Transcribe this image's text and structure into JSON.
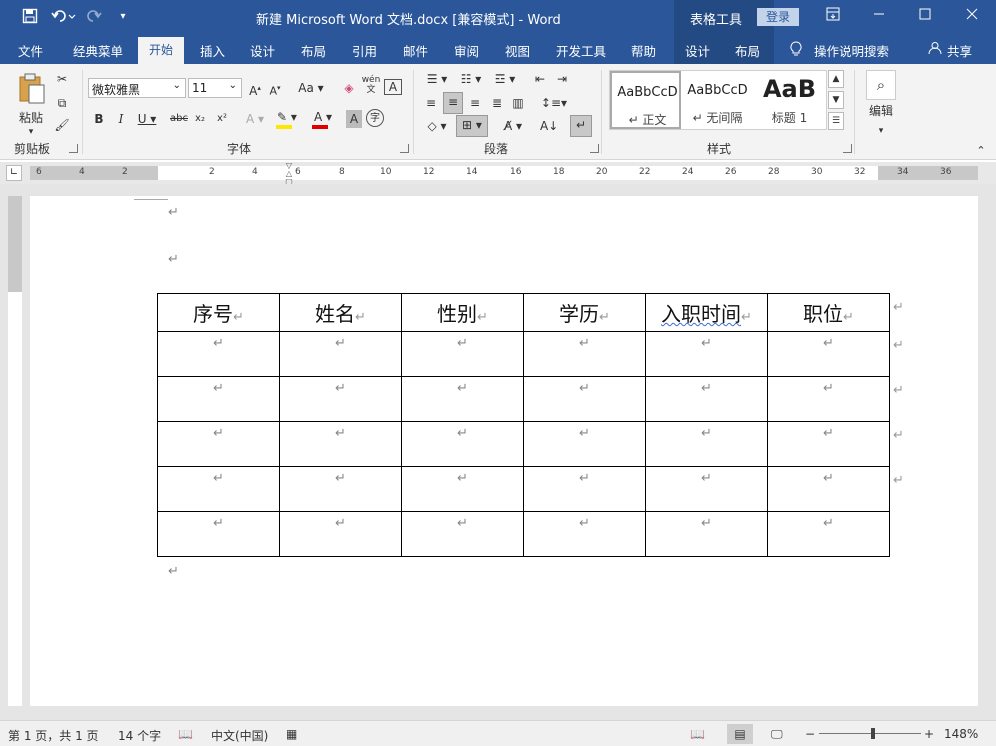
{
  "titlebar": {
    "doc_title": "新建 Microsoft Word 文档.docx [兼容模式]  -  Word",
    "context_tab": "表格工具",
    "login": "登录",
    "undo_icon": "undo-icon",
    "redo_icon": "redo-icon",
    "save_icon": "save-icon"
  },
  "menu": {
    "items": [
      "文件",
      "经典菜单",
      "开始",
      "插入",
      "设计",
      "布局",
      "引用",
      "邮件",
      "审阅",
      "视图",
      "开发工具",
      "帮助"
    ],
    "context_items": [
      "设计",
      "布局"
    ],
    "tell_me": "操作说明搜索",
    "share": "共享"
  },
  "ribbon": {
    "clipboard": {
      "paste": "粘贴",
      "label": "剪贴板"
    },
    "font": {
      "name": "微软雅黑",
      "size": "11",
      "label": "字体",
      "wen": "wén",
      "wen_char": "文"
    },
    "paragraph": {
      "label": "段落"
    },
    "styles": {
      "label": "样式",
      "items": [
        {
          "preview": "AaBbCcD",
          "name": "↵ 正文"
        },
        {
          "preview": "AaBbCcD",
          "name": "↵ 无间隔"
        },
        {
          "preview": "AaB",
          "name": "标题 1"
        }
      ]
    },
    "editing": {
      "label": "编辑"
    }
  },
  "ruler": {
    "numbers": [
      "6",
      "4",
      "2",
      "2",
      "4",
      "6",
      "8",
      "10",
      "12",
      "14",
      "16",
      "18",
      "20",
      "22",
      "24",
      "26",
      "28",
      "30",
      "32",
      "34",
      "36"
    ]
  },
  "document": {
    "return_mark": "↵",
    "table": {
      "headers": [
        "序号",
        "姓名",
        "性别",
        "学历",
        "入职时间",
        "职位"
      ],
      "rows": [
        [
          "↵",
          "↵",
          "↵",
          "↵",
          "↵",
          "↵"
        ],
        [
          "↵",
          "↵",
          "↵",
          "↵",
          "↵",
          "↵"
        ],
        [
          "↵",
          "↵",
          "↵",
          "↵",
          "↵",
          "↵"
        ],
        [
          "↵",
          "↵",
          "↵",
          "↵",
          "↵",
          "↵"
        ],
        [
          "↵",
          "↵",
          "↵",
          "↵",
          "↵",
          "↵"
        ]
      ]
    }
  },
  "status": {
    "page": "第 1 页，共 1 页",
    "words": "14 个字",
    "language": "中文(中国)",
    "zoom": "148%"
  },
  "colors": {
    "brand": "#2b579a",
    "context": "#234a82"
  }
}
